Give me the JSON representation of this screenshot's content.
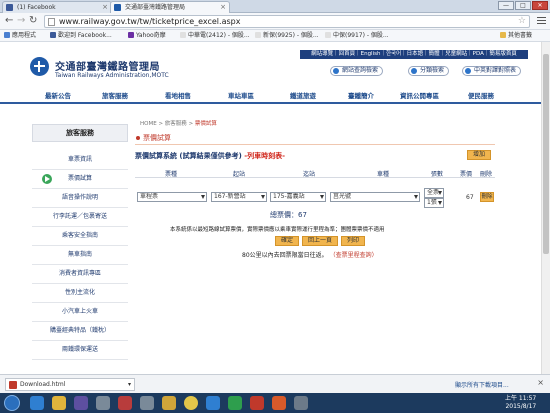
{
  "browser": {
    "tabs": [
      {
        "label": "(1) Facebook",
        "close": "×"
      },
      {
        "label": "交通部臺灣鐵路管理局",
        "close": "×"
      }
    ],
    "url": "www.railway.gov.tw/tw/ticketprice_excel.aspx",
    "bookmarks": [
      "應用程式",
      "歡迎到 Facebook...",
      "Yahoo奇摩",
      "中華電(2412) - 個股...",
      "新保(9925) - 個股...",
      "中保(9917) - 個股...",
      "其他書籤"
    ],
    "window_buttons": {
      "minimize": "—",
      "maximize": "□",
      "close": "✕"
    }
  },
  "site": {
    "title": "交通部臺灣鐵路管理局",
    "subtitle": "Taiwan Railways Administration,MOTC",
    "top_links": "網站導覽｜回首頁｜English｜한국어｜日本語｜簡體｜兒童網站｜PDA｜簡易版首頁",
    "pill_buttons": [
      "網站查詢檢索",
      "分類檢索",
      "中英對譯對照表"
    ]
  },
  "nav": [
    "最新公告",
    "旅客服務",
    "看地相售",
    "車站車區",
    "鐵道旅遊",
    "臺鐵簡介",
    "資訊公開專區",
    "便民服務"
  ],
  "sidebar": {
    "heading": "旅客服務",
    "items": [
      "車票資訊",
      "票價試算",
      "語音操作說明",
      "行李託運／包裹寄送",
      "乘客安全指南",
      "無車指南",
      "消費者資訊專區",
      "性別主流化",
      "小汽車上火車",
      "購臺經典特品（鐵枕）",
      "兩鐵環保運送"
    ]
  },
  "breadcrumb": {
    "home": "HOME",
    "sep": ">",
    "section": "旅客服務",
    "current": "票價試算"
  },
  "page_title": "票價試算",
  "form": {
    "title": "票價試算系統 (試算結果僅供參考)",
    "title_note": "-列車時刻表-",
    "add_label": "增加",
    "headers": [
      "票種",
      "起站",
      "迄站",
      "車種",
      "張數",
      "票價",
      "刪除"
    ],
    "row": {
      "ticket_type": "單程票",
      "from": "167-新營站",
      "to": "175-嘉義站",
      "train": "莒光號",
      "count_type": "全票",
      "count": "1張",
      "price": "67",
      "delete": "刪除"
    },
    "total": "總票價：67",
    "note": "本系統係以最短路線試算票價，實際票價應以乘車實際運行里程為準；團體票票價不適用",
    "buttons": [
      "確定",
      "回上一頁",
      "列印"
    ],
    "footer_text": "80公里以內去回票限當日往返。",
    "footer_link": "（查票里程查詢）"
  },
  "download": {
    "file": "Download.html",
    "show_all": "顯示所有下載項目...",
    "close": "×"
  },
  "taskbar": {
    "time": "上午 11:57",
    "date": "2015/8/17"
  }
}
